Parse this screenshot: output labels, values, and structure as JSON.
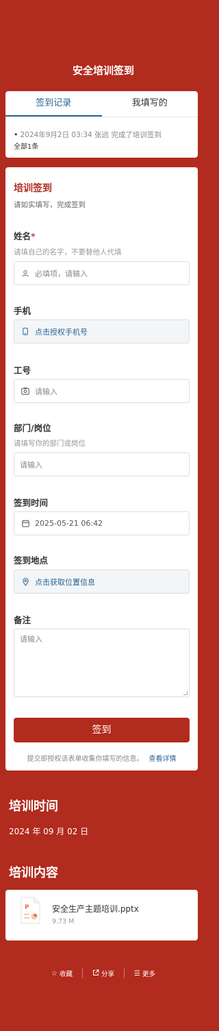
{
  "page_title": "安全培训签到",
  "tabs": [
    {
      "label": "签到记录",
      "active": true
    },
    {
      "label": "我填写的",
      "active": false
    }
  ],
  "record": {
    "text": "2024年9月2日 03:34  张远 完成了培训签到",
    "count": "全部1条"
  },
  "form": {
    "title": "培训签到",
    "subtitle": "请如实填写，完成签到",
    "name": {
      "label": "姓名",
      "required_mark": "*",
      "hint": "请填自己的名字，不要替他人代填",
      "placeholder": "必填项，请输入",
      "icon": "user-icon"
    },
    "phone": {
      "label": "手机",
      "action": "点击授权手机号",
      "icon": "phone-icon"
    },
    "employee_id": {
      "label": "工号",
      "placeholder": "请输入",
      "icon": "id-card-icon"
    },
    "dept": {
      "label": "部门/岗位",
      "hint": "请填写你的部门或岗位",
      "placeholder": "请输入"
    },
    "checkin_time": {
      "label": "签到时间",
      "value": "2025-05-21 06:42",
      "icon": "calendar-icon"
    },
    "location": {
      "label": "签到地点",
      "action": "点击获取位置信息",
      "icon": "location-icon"
    },
    "remark": {
      "label": "备注",
      "placeholder": "请输入"
    },
    "submit_label": "签到",
    "consent_text": "提交即授权该表单收集你填写的信息。",
    "consent_link": "查看详情"
  },
  "training_time": {
    "title": "培训时间",
    "value": "2024 年 09 月 02 日"
  },
  "training_content": {
    "title": "培训内容",
    "file_name": "安全生产主题培训.pptx",
    "file_size": "9.73 M",
    "file_icon": "pptx-file-icon"
  },
  "footer": [
    {
      "label": "收藏",
      "icon": "star-icon"
    },
    {
      "label": "分享",
      "icon": "share-icon"
    },
    {
      "label": "更多",
      "icon": "menu-icon"
    }
  ],
  "colors": {
    "brand": "#b12b1e",
    "link": "#2a6496"
  }
}
